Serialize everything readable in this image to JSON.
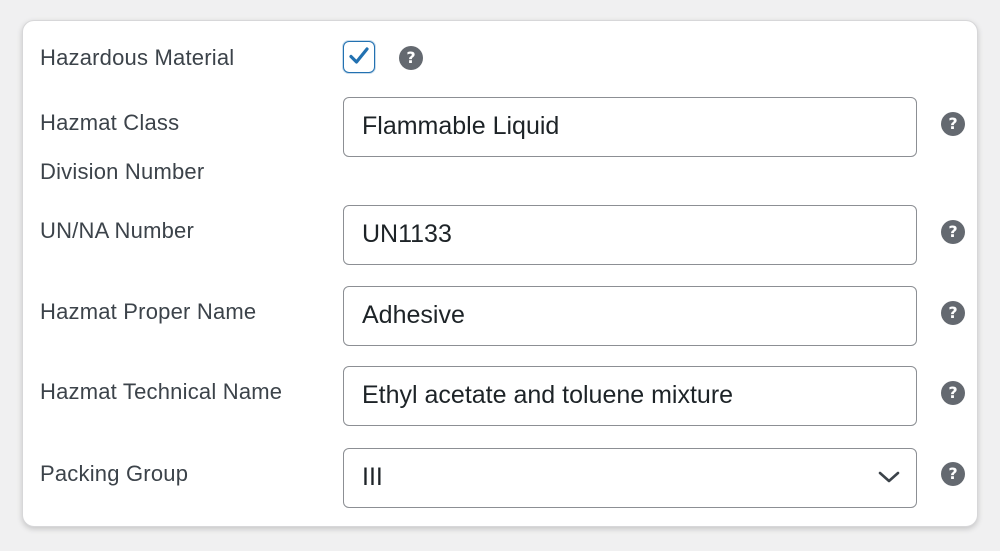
{
  "form": {
    "hazardous": {
      "label": "Hazardous Material",
      "checked": true,
      "help_icon": "question-circle-icon"
    },
    "hazmat_class": {
      "label_line1": "Hazmat Class",
      "label_line2": "Division Number",
      "value": "Flammable Liquid"
    },
    "un_na_number": {
      "label": "UN/NA Number",
      "value": "UN1133"
    },
    "proper_name": {
      "label": "Hazmat Proper Name",
      "value": "Adhesive"
    },
    "technical_name": {
      "label": "Hazmat Technical Name",
      "value": "Ethyl acetate and toluene mixture"
    },
    "packing_group": {
      "label": "Packing Group",
      "value": "III",
      "icon": "chevron-down-icon"
    },
    "help_glyph": "?"
  },
  "colors": {
    "accent": "#2271b1",
    "help_icon": "#646970",
    "border": "#8c8f94",
    "text": "#3c434a"
  }
}
